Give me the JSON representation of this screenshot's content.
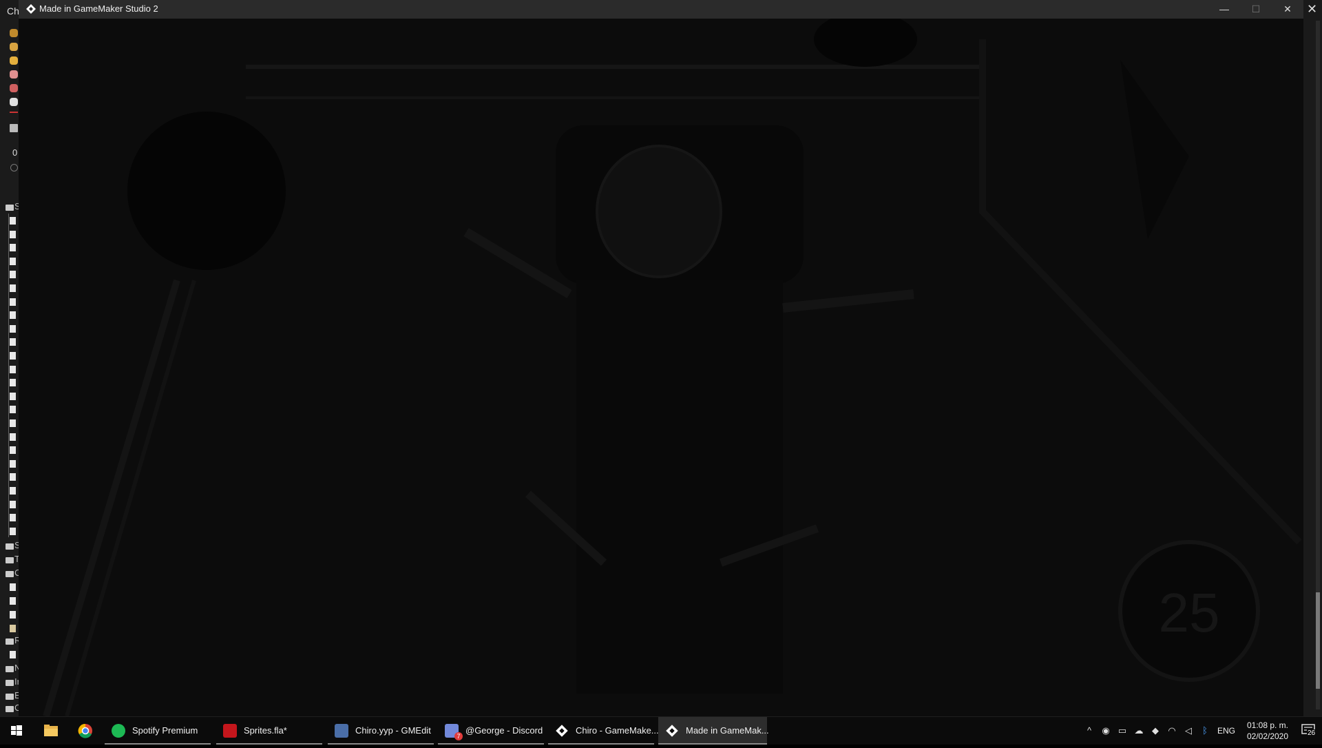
{
  "background_ide": {
    "title_fragment": "Ch",
    "counter": "0",
    "tree_labels": [
      "S",
      "S",
      "T",
      "C",
      "R",
      "N",
      "Ir",
      "E",
      "C"
    ]
  },
  "game_window": {
    "title": "Made in GameMaker Studio 2",
    "minimize_glyph": "—",
    "maximize_glyph": "☐",
    "close_glyph": "✕",
    "scene_text": "25"
  },
  "background_right": {
    "close_glyph": "✕"
  },
  "taskbar": {
    "items": [
      {
        "label": "Spotify Premium",
        "icon": "spotify-icon",
        "color": "#1db954"
      },
      {
        "label": "Sprites.fla*",
        "icon": "flash-icon",
        "color": "#c4161c"
      },
      {
        "label": "Chiro.yyp - GMEdit",
        "icon": "gmedit-icon",
        "color": "#4a6ea8"
      },
      {
        "label": "@George - Discord",
        "icon": "discord-icon",
        "color": "#7289da",
        "badge": "7"
      },
      {
        "label": "Chiro - GameMake...",
        "icon": "gamemaker-icon",
        "color": "#ffffff"
      },
      {
        "label": "Made in GameMak...",
        "icon": "gamemaker-icon",
        "color": "#ffffff",
        "active": true
      }
    ],
    "tray": {
      "language": "ENG",
      "time": "01:08 p. m.",
      "date": "02/02/2020",
      "notification_count": "26"
    }
  },
  "colors": {
    "taskbar_bg": "#0b0b0b",
    "titlebar_bg": "#2b2b2b",
    "canvas_bg": "#0c0c0c"
  }
}
